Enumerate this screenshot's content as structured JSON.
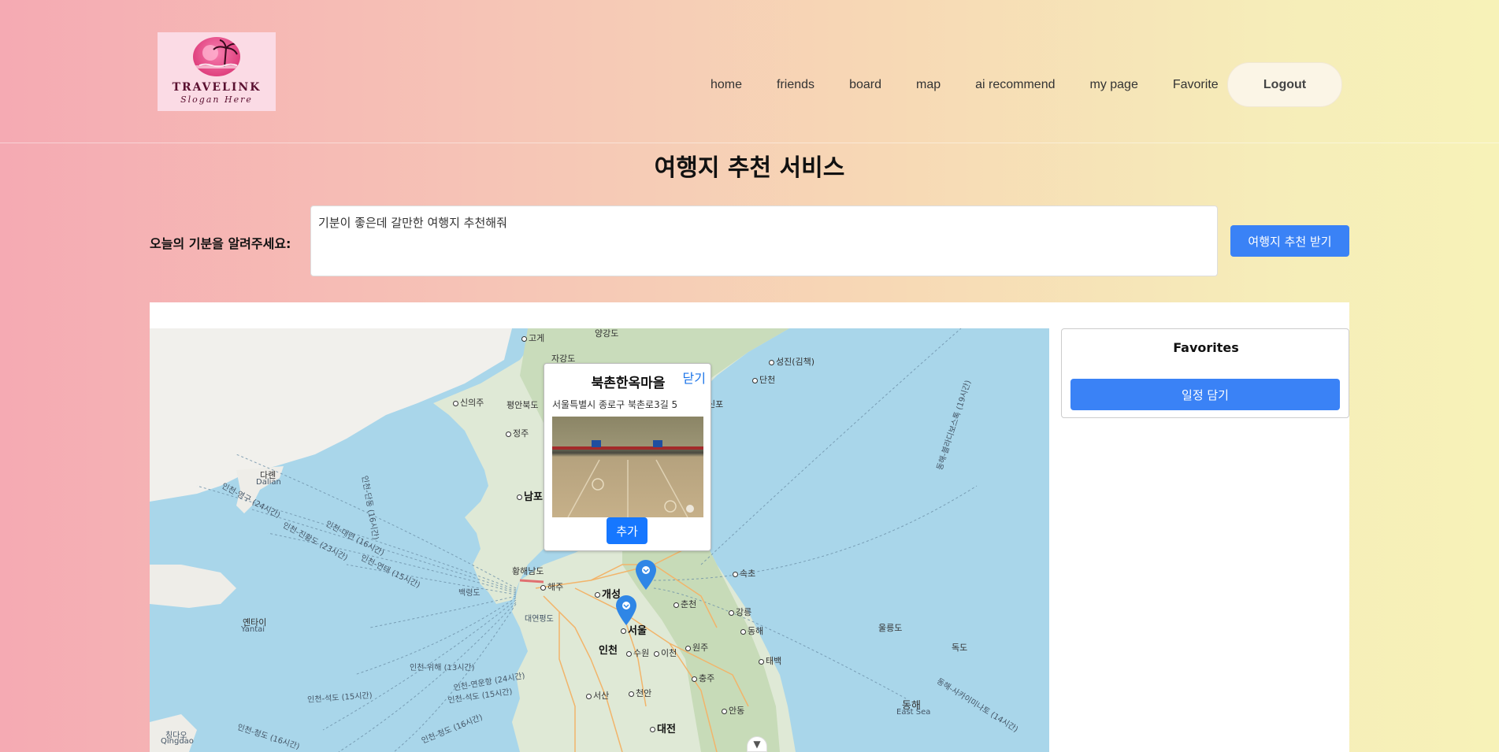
{
  "logo": {
    "name": "TRAVELINK",
    "slogan": "Slogan Here"
  },
  "nav": {
    "items": [
      {
        "label": "home"
      },
      {
        "label": "friends"
      },
      {
        "label": "board"
      },
      {
        "label": "map"
      },
      {
        "label": "ai recommend"
      },
      {
        "label": "my page"
      },
      {
        "label": "Favorite"
      }
    ],
    "logout_label": "Logout"
  },
  "page": {
    "title": "여행지 추천 서비스"
  },
  "mood": {
    "label": "오늘의 기분을 알려주세요:",
    "value": "기분이 좋은데 갈만한 여행지 추천해줘",
    "submit_label": "여행지 추천 받기"
  },
  "map": {
    "labels": {
      "goyang": "양강도",
      "gojeong": "고게",
      "jagang": "자강도",
      "seongjin": "성진(김책)",
      "sinuiju": "신의주",
      "pyeongbuk": "평안북도",
      "dancheon": "단천",
      "sinpo": "신포",
      "jeongju": "정주",
      "dalian": "다롄",
      "dalian_en": "Dalian",
      "nampo": "남포",
      "hwanghae": "황해남도",
      "haeju": "해주",
      "baengnyeong": "백령도",
      "gaeseong": "개성",
      "daeyeonpyeong": "대연평도",
      "yantai": "옌타이",
      "yantai_en": "Yantai",
      "incheon": "인천",
      "seoul": "서울",
      "suwon": "수원",
      "icheon": "이천",
      "chuncheon": "춘천",
      "gangneung": "강릉",
      "sokcho": "속초",
      "donghae": "동해",
      "wonju": "원주",
      "taebaek": "태백",
      "chungju": "충주",
      "seosan": "서산",
      "cheonan": "천안",
      "andong": "안동",
      "daejeon": "대전",
      "ulleungdo": "울릉도",
      "dokdo": "독도",
      "eastsea": "동해",
      "eastsea_en": "East Sea",
      "qingdao": "칭다오",
      "qingdao_en": "Qingdao"
    },
    "route_labels": {
      "r1": "인천-영구 (24시간)",
      "r2": "인천-진황도 (23시간)",
      "r3": "인천-대련 (16시간)",
      "r4": "인천-단동 (16시간)",
      "r5": "인천-연태 (15시간)",
      "r6": "인천-위해 (13시간)",
      "r7": "인천-연운항 (24시간)",
      "r8": "인천-석도 (15시간)",
      "r9": "인천-석도 (15시간)",
      "r10": "인천-청도 (16시간)",
      "r11": "인천-청도 (16시간)",
      "r12": "동해-블라디보스톡 (19시간)",
      "r13": "동해-사카이미나토 (14시간)"
    }
  },
  "popup": {
    "title": "북촌한옥마을",
    "close_label": "닫기",
    "address": "서울특별시 종로구 북촌로3길 5",
    "add_label": "추가"
  },
  "favorites": {
    "title": "Favorites",
    "save_label": "일정 담기"
  },
  "colors": {
    "primary_button": "#3a82f6",
    "popup_add_button": "#1677ff",
    "pin": "#2f86e6",
    "sea": "#a9d6ea"
  }
}
